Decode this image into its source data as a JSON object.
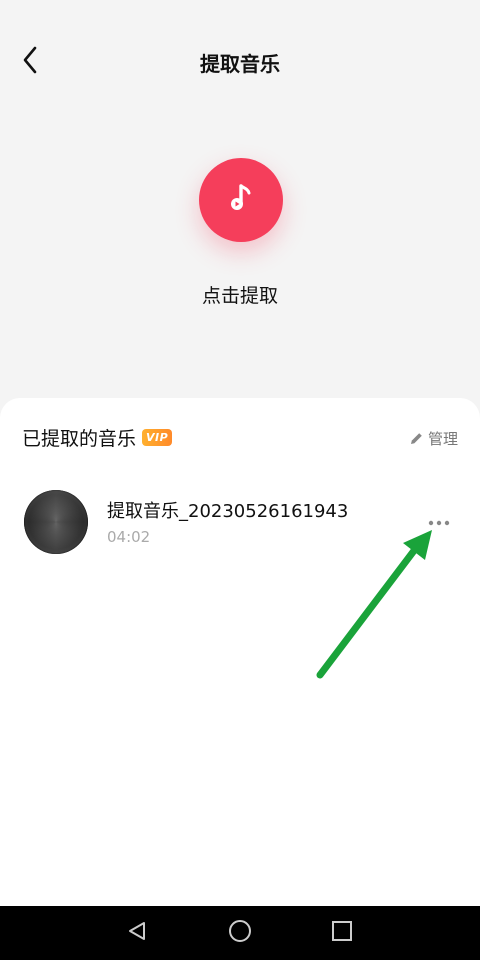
{
  "header": {
    "title": "提取音乐",
    "back_icon": "chevron-left-icon"
  },
  "extract": {
    "icon": "music-note-icon",
    "label": "点击提取",
    "accent_color": "#f53e5b"
  },
  "extracted_section": {
    "title": "已提取的音乐",
    "badge": "VIP",
    "manage_label": "管理",
    "manage_icon": "pencil-icon",
    "items": [
      {
        "name": "提取音乐_20230526161943",
        "duration": "04:02",
        "more_icon": "more-dots-icon"
      }
    ]
  },
  "annotation": {
    "type": "arrow",
    "color": "#1aa33a",
    "points_to": "more-button"
  },
  "nav_bar": {
    "buttons": [
      "back-triangle-icon",
      "home-circle-icon",
      "recents-square-icon"
    ]
  }
}
